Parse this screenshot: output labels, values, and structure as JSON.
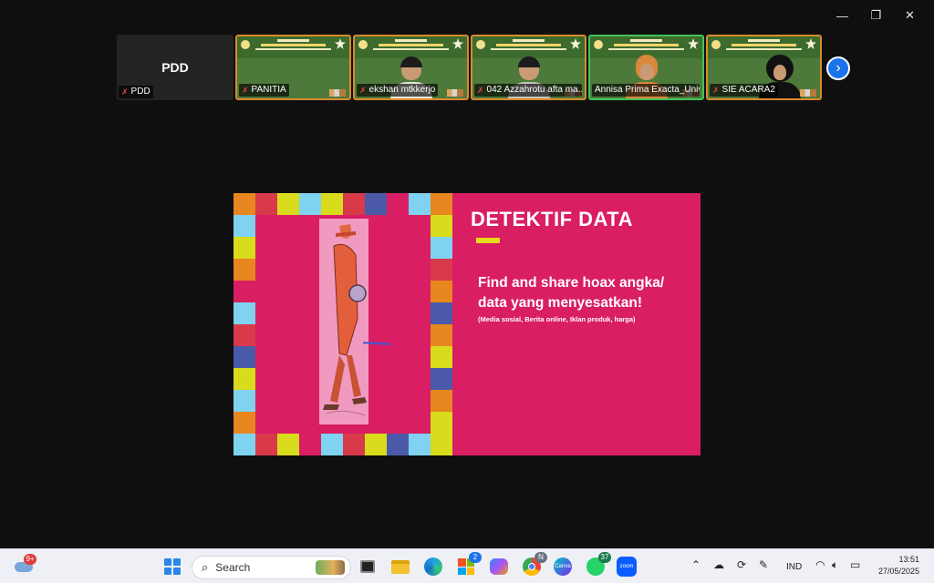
{
  "window": {
    "controls": {
      "minimize": "—",
      "restore": "❐",
      "close": "✕"
    }
  },
  "participants": [
    {
      "name": "PDD",
      "display": "PDD",
      "type": "name-only",
      "muted": true
    },
    {
      "name": "PANITIA",
      "type": "video",
      "muted": true,
      "person": "none"
    },
    {
      "name": "ekshan mtkkerjo",
      "type": "video",
      "muted": true,
      "person": "man"
    },
    {
      "name": "042 Azzahrotu afta ma...",
      "type": "video",
      "muted": true,
      "person": "girl"
    },
    {
      "name": "Annisa Prima Exacta_Univ...",
      "type": "video",
      "muted": false,
      "person": "hijab-orange",
      "active": true
    },
    {
      "name": "SIE ACARA2",
      "type": "video",
      "muted": true,
      "person": "hijab-black"
    }
  ],
  "slide": {
    "title": "DETEKTIF DATA",
    "body": "Find and share hoax angka/ data yang menyesatkan!",
    "subtitle": "(Media sosial, Berita online, Iklan produk, harga)",
    "colors": {
      "background": "#d91e63",
      "accent": "#e6d81c"
    }
  },
  "taskbar": {
    "weather_badge": "9+",
    "search_placeholder": "Search",
    "store_badge": "2",
    "whatsapp_badge": "37",
    "zoom_label": "zoom",
    "language": "IND",
    "time": "13:51",
    "date": "27/05/2025",
    "icons": [
      "start-icon",
      "search-icon",
      "task-view-icon",
      "file-explorer-icon",
      "edge-icon",
      "microsoft-store-icon",
      "copilot-icon",
      "chrome-icon",
      "canva-icon",
      "whatsapp-icon",
      "zoom-icon"
    ]
  }
}
